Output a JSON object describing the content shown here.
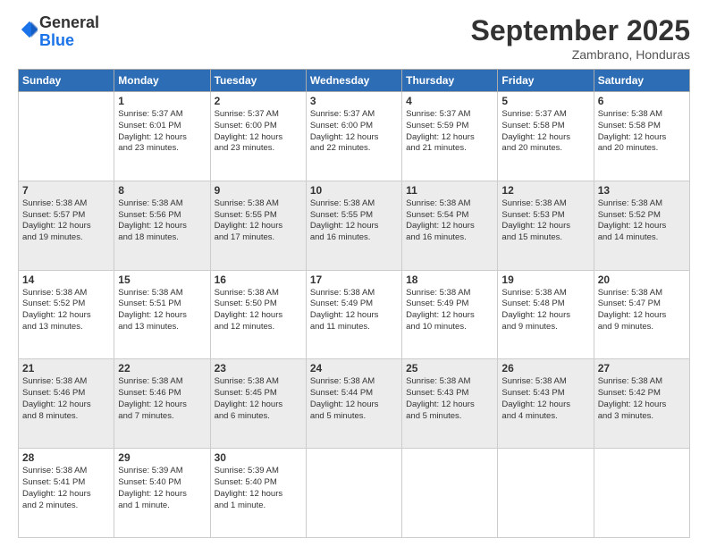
{
  "header": {
    "logo_general": "General",
    "logo_blue": "Blue",
    "month": "September 2025",
    "location": "Zambrano, Honduras"
  },
  "weekdays": [
    "Sunday",
    "Monday",
    "Tuesday",
    "Wednesday",
    "Thursday",
    "Friday",
    "Saturday"
  ],
  "weeks": [
    [
      {
        "day": "",
        "info": ""
      },
      {
        "day": "1",
        "info": "Sunrise: 5:37 AM\nSunset: 6:01 PM\nDaylight: 12 hours\nand 23 minutes."
      },
      {
        "day": "2",
        "info": "Sunrise: 5:37 AM\nSunset: 6:00 PM\nDaylight: 12 hours\nand 23 minutes."
      },
      {
        "day": "3",
        "info": "Sunrise: 5:37 AM\nSunset: 6:00 PM\nDaylight: 12 hours\nand 22 minutes."
      },
      {
        "day": "4",
        "info": "Sunrise: 5:37 AM\nSunset: 5:59 PM\nDaylight: 12 hours\nand 21 minutes."
      },
      {
        "day": "5",
        "info": "Sunrise: 5:37 AM\nSunset: 5:58 PM\nDaylight: 12 hours\nand 20 minutes."
      },
      {
        "day": "6",
        "info": "Sunrise: 5:38 AM\nSunset: 5:58 PM\nDaylight: 12 hours\nand 20 minutes."
      }
    ],
    [
      {
        "day": "7",
        "info": "Sunrise: 5:38 AM\nSunset: 5:57 PM\nDaylight: 12 hours\nand 19 minutes."
      },
      {
        "day": "8",
        "info": "Sunrise: 5:38 AM\nSunset: 5:56 PM\nDaylight: 12 hours\nand 18 minutes."
      },
      {
        "day": "9",
        "info": "Sunrise: 5:38 AM\nSunset: 5:55 PM\nDaylight: 12 hours\nand 17 minutes."
      },
      {
        "day": "10",
        "info": "Sunrise: 5:38 AM\nSunset: 5:55 PM\nDaylight: 12 hours\nand 16 minutes."
      },
      {
        "day": "11",
        "info": "Sunrise: 5:38 AM\nSunset: 5:54 PM\nDaylight: 12 hours\nand 16 minutes."
      },
      {
        "day": "12",
        "info": "Sunrise: 5:38 AM\nSunset: 5:53 PM\nDaylight: 12 hours\nand 15 minutes."
      },
      {
        "day": "13",
        "info": "Sunrise: 5:38 AM\nSunset: 5:52 PM\nDaylight: 12 hours\nand 14 minutes."
      }
    ],
    [
      {
        "day": "14",
        "info": "Sunrise: 5:38 AM\nSunset: 5:52 PM\nDaylight: 12 hours\nand 13 minutes."
      },
      {
        "day": "15",
        "info": "Sunrise: 5:38 AM\nSunset: 5:51 PM\nDaylight: 12 hours\nand 13 minutes."
      },
      {
        "day": "16",
        "info": "Sunrise: 5:38 AM\nSunset: 5:50 PM\nDaylight: 12 hours\nand 12 minutes."
      },
      {
        "day": "17",
        "info": "Sunrise: 5:38 AM\nSunset: 5:49 PM\nDaylight: 12 hours\nand 11 minutes."
      },
      {
        "day": "18",
        "info": "Sunrise: 5:38 AM\nSunset: 5:49 PM\nDaylight: 12 hours\nand 10 minutes."
      },
      {
        "day": "19",
        "info": "Sunrise: 5:38 AM\nSunset: 5:48 PM\nDaylight: 12 hours\nand 9 minutes."
      },
      {
        "day": "20",
        "info": "Sunrise: 5:38 AM\nSunset: 5:47 PM\nDaylight: 12 hours\nand 9 minutes."
      }
    ],
    [
      {
        "day": "21",
        "info": "Sunrise: 5:38 AM\nSunset: 5:46 PM\nDaylight: 12 hours\nand 8 minutes."
      },
      {
        "day": "22",
        "info": "Sunrise: 5:38 AM\nSunset: 5:46 PM\nDaylight: 12 hours\nand 7 minutes."
      },
      {
        "day": "23",
        "info": "Sunrise: 5:38 AM\nSunset: 5:45 PM\nDaylight: 12 hours\nand 6 minutes."
      },
      {
        "day": "24",
        "info": "Sunrise: 5:38 AM\nSunset: 5:44 PM\nDaylight: 12 hours\nand 5 minutes."
      },
      {
        "day": "25",
        "info": "Sunrise: 5:38 AM\nSunset: 5:43 PM\nDaylight: 12 hours\nand 5 minutes."
      },
      {
        "day": "26",
        "info": "Sunrise: 5:38 AM\nSunset: 5:43 PM\nDaylight: 12 hours\nand 4 minutes."
      },
      {
        "day": "27",
        "info": "Sunrise: 5:38 AM\nSunset: 5:42 PM\nDaylight: 12 hours\nand 3 minutes."
      }
    ],
    [
      {
        "day": "28",
        "info": "Sunrise: 5:38 AM\nSunset: 5:41 PM\nDaylight: 12 hours\nand 2 minutes."
      },
      {
        "day": "29",
        "info": "Sunrise: 5:39 AM\nSunset: 5:40 PM\nDaylight: 12 hours\nand 1 minute."
      },
      {
        "day": "30",
        "info": "Sunrise: 5:39 AM\nSunset: 5:40 PM\nDaylight: 12 hours\nand 1 minute."
      },
      {
        "day": "",
        "info": ""
      },
      {
        "day": "",
        "info": ""
      },
      {
        "day": "",
        "info": ""
      },
      {
        "day": "",
        "info": ""
      }
    ]
  ]
}
